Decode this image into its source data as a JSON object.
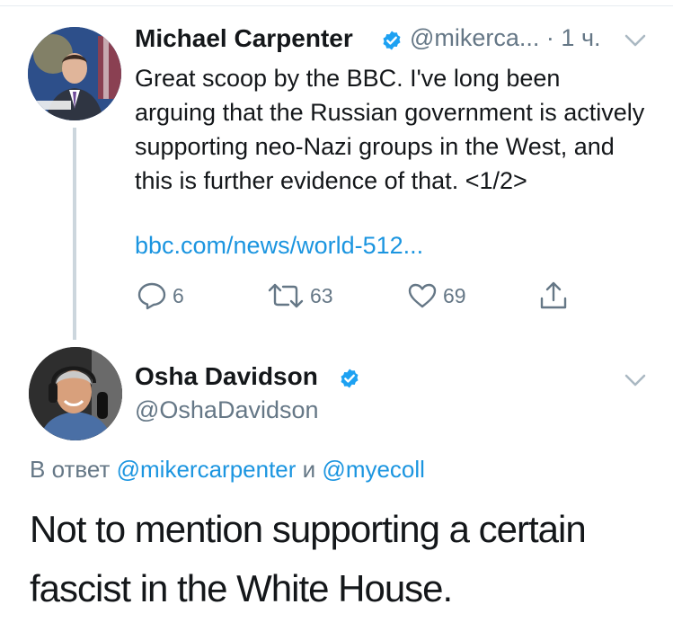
{
  "tweet1": {
    "author_name": "Michael Carpenter",
    "meta": "@mikerca... · 1 ч.",
    "text": "Great scoop by the BBC. I've long been arguing that the Russian government is actively supporting neo-Nazi groups in the West, and this is further evidence of that. <1/2>",
    "link": "bbc.com/news/world-512...",
    "reply_count": "6",
    "retweet_count": "63",
    "like_count": "69"
  },
  "tweet2": {
    "author_name": "Osha Davidson",
    "handle": "@OshaDavidson",
    "reply_prefix": "В ответ",
    "reply_mention_1": "@mikercarpenter",
    "reply_conjunction": "и",
    "reply_mention_2": "@myecoll",
    "text": "Not to mention supporting a certain fascist in the White House."
  },
  "colors": {
    "link": "#1b95e0",
    "secondary_text": "#657786",
    "verified": "#1da1f2",
    "thread_line": "#ccd6dd"
  },
  "icons": {
    "verified": "verified-badge-icon",
    "caret": "chevron-down-icon",
    "reply": "reply-icon",
    "retweet": "retweet-icon",
    "like": "heart-icon",
    "share": "share-icon"
  }
}
